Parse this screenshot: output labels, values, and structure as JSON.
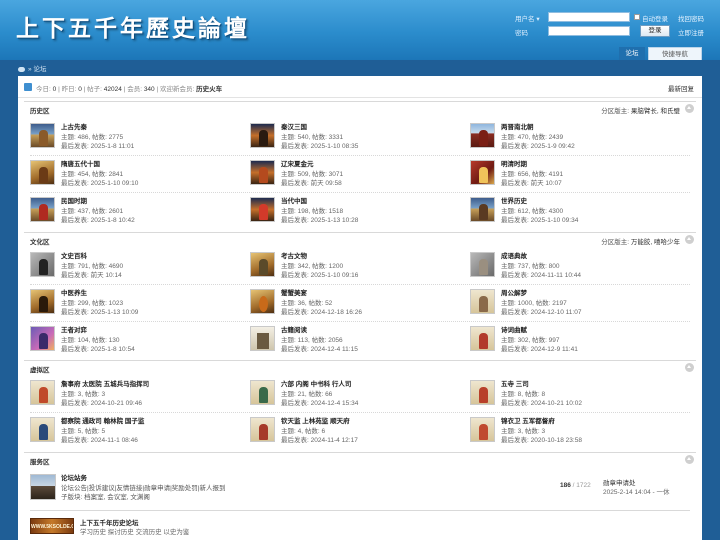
{
  "header": {
    "logo_text": "上下五千年歷史論壇",
    "login": {
      "username_label": "用户名",
      "username_arrow": "▾",
      "password_label": "密码",
      "auto_login_label": "自动登录",
      "forgot_link": "找回密码",
      "login_button": "登录",
      "register_link": "立即注册"
    },
    "nav_tabs": [
      "论坛",
      "快捷导航"
    ]
  },
  "breadcrumb": {
    "separator": "»",
    "current": "论坛"
  },
  "stats": {
    "today_label": "今日:",
    "today": "0",
    "yesterday_label": "昨日:",
    "yesterday": "0",
    "posts_label": "帖子:",
    "posts": "42024",
    "members_label": "会员:",
    "members": "340",
    "welcome_label": "欢迎新会员:",
    "newest_member": "历史火车",
    "sep": "|",
    "latest_replies_link": "最新回复"
  },
  "sections": [
    {
      "title": "历史区",
      "moderators_label": "分区版主:",
      "moderators": "果脑臂长, 和氏璧",
      "forums": [
        {
          "name": "上古先秦",
          "stats": "主题: 486, 帖数: 2775",
          "last": "最后发表: 2025-1-8 11:01"
        },
        {
          "name": "秦汉三国",
          "stats": "主题: 540, 帖数: 3331",
          "last": "最后发表: 2025-1-10 08:35"
        },
        {
          "name": "两晋南北朝",
          "stats": "主题: 470, 帖数: 2439",
          "last": "最后发表: 2025-1-9 09:42"
        },
        {
          "name": "隋唐五代十国",
          "stats": "主题: 454, 帖数: 2841",
          "last": "最后发表: 2025-1-10 09:10"
        },
        {
          "name": "辽宋夏金元",
          "stats": "主题: 509, 帖数: 3071",
          "last": "最后发表: 前天 09:58"
        },
        {
          "name": "明清时期",
          "stats": "主题: 656, 帖数: 4191",
          "last": "最后发表: 前天 10:07"
        },
        {
          "name": "民国时期",
          "stats": "主题: 437, 帖数: 2601",
          "last": "最后发表: 2025-1-8 10:42"
        },
        {
          "name": "当代中国",
          "stats": "主题: 198, 帖数: 1518",
          "last": "最后发表: 2025-1-13 10:28"
        },
        {
          "name": "世界历史",
          "stats": "主题: 612, 帖数: 4300",
          "last": "最后发表: 2025-1-10 09:34"
        }
      ]
    },
    {
      "title": "文化区",
      "moderators_label": "分区版主:",
      "moderators": "万能胶, 嘻哈少年",
      "forums": [
        {
          "name": "文史百科",
          "stats": "主题: 791, 帖数: 4690",
          "last": "最后发表: 前天 10:14"
        },
        {
          "name": "考古文物",
          "stats": "主题: 342, 帖数: 1200",
          "last": "最后发表: 2025-1-10 09:16"
        },
        {
          "name": "成语典故",
          "stats": "主题: 737, 帖数: 800",
          "last": "最后发表: 2024-11-11 10:44"
        },
        {
          "name": "中医养生",
          "stats": "主题: 299, 帖数: 1023",
          "last": "最后发表: 2025-1-13 10:09"
        },
        {
          "name": "蟹蟹美宴",
          "stats": "主题: 36, 帖数: 52",
          "last": "最后发表: 2024-12-18 16:26"
        },
        {
          "name": "周公解梦",
          "stats": "主题: 1000, 帖数: 2197",
          "last": "最后发表: 2024-12-10 11:07"
        },
        {
          "name": "王者对弈",
          "stats": "主题: 104, 帖数: 130",
          "last": "最后发表: 2025-1-8 10:54"
        },
        {
          "name": "古籍阅读",
          "stats": "主题: 113, 帖数: 2056",
          "last": "最后发表: 2024-12-4 11:15"
        },
        {
          "name": "诗词曲赋",
          "stats": "主题: 302, 帖数: 997",
          "last": "最后发表: 2024-12-9 11:41"
        }
      ]
    },
    {
      "title": "虚拟区",
      "forums": [
        {
          "name": "詹事府 太医院 五城兵马指挥司",
          "stats": "主题: 3, 帖数: 3",
          "last": "最后发表: 2024-10-21 09:46"
        },
        {
          "name": "六部 内阁 中书科 行人司",
          "stats": "主题: 21, 帖数: 66",
          "last": "最后发表: 2024-12-4 15:34"
        },
        {
          "name": "五寺 三司",
          "stats": "主题: 8, 帖数: 8",
          "last": "最后发表: 2024-10-21 10:02"
        },
        {
          "name": "都察院 通政司 翰林院 国子监",
          "stats": "主题: 5, 帖数: 5",
          "last": "最后发表: 2024-11-1 08:46"
        },
        {
          "name": "钦天监 上林苑监 顺天府",
          "stats": "主题: 4, 帖数: 6",
          "last": "最后发表: 2024-11-4 12:17"
        },
        {
          "name": "锦衣卫 五军都督府",
          "stats": "主题: 3, 帖数: 3",
          "last": "最后发表: 2020-10-18 23:58"
        }
      ]
    },
    {
      "title": "服务区",
      "forums": []
    }
  ],
  "service": {
    "name": "论坛站务",
    "links": "论坛公告|投诉建议|友情链接|勋章申请|奖励处罚|新人报到",
    "subs_label": "子版块:",
    "subs": "档案室, 会议室, 文渊阁",
    "count_main": "186",
    "count_sep": "/",
    "count_total": "1722",
    "last_title": "勋章申请处",
    "last_time": "2025-2-14 14:04 - 一休"
  },
  "link_banner": {
    "image_text": "WWW.5KSOLDE.COM",
    "name": "上下五千年历史论坛",
    "desc": "学习历史 探讨历史 交流历史 以史为鉴"
  }
}
